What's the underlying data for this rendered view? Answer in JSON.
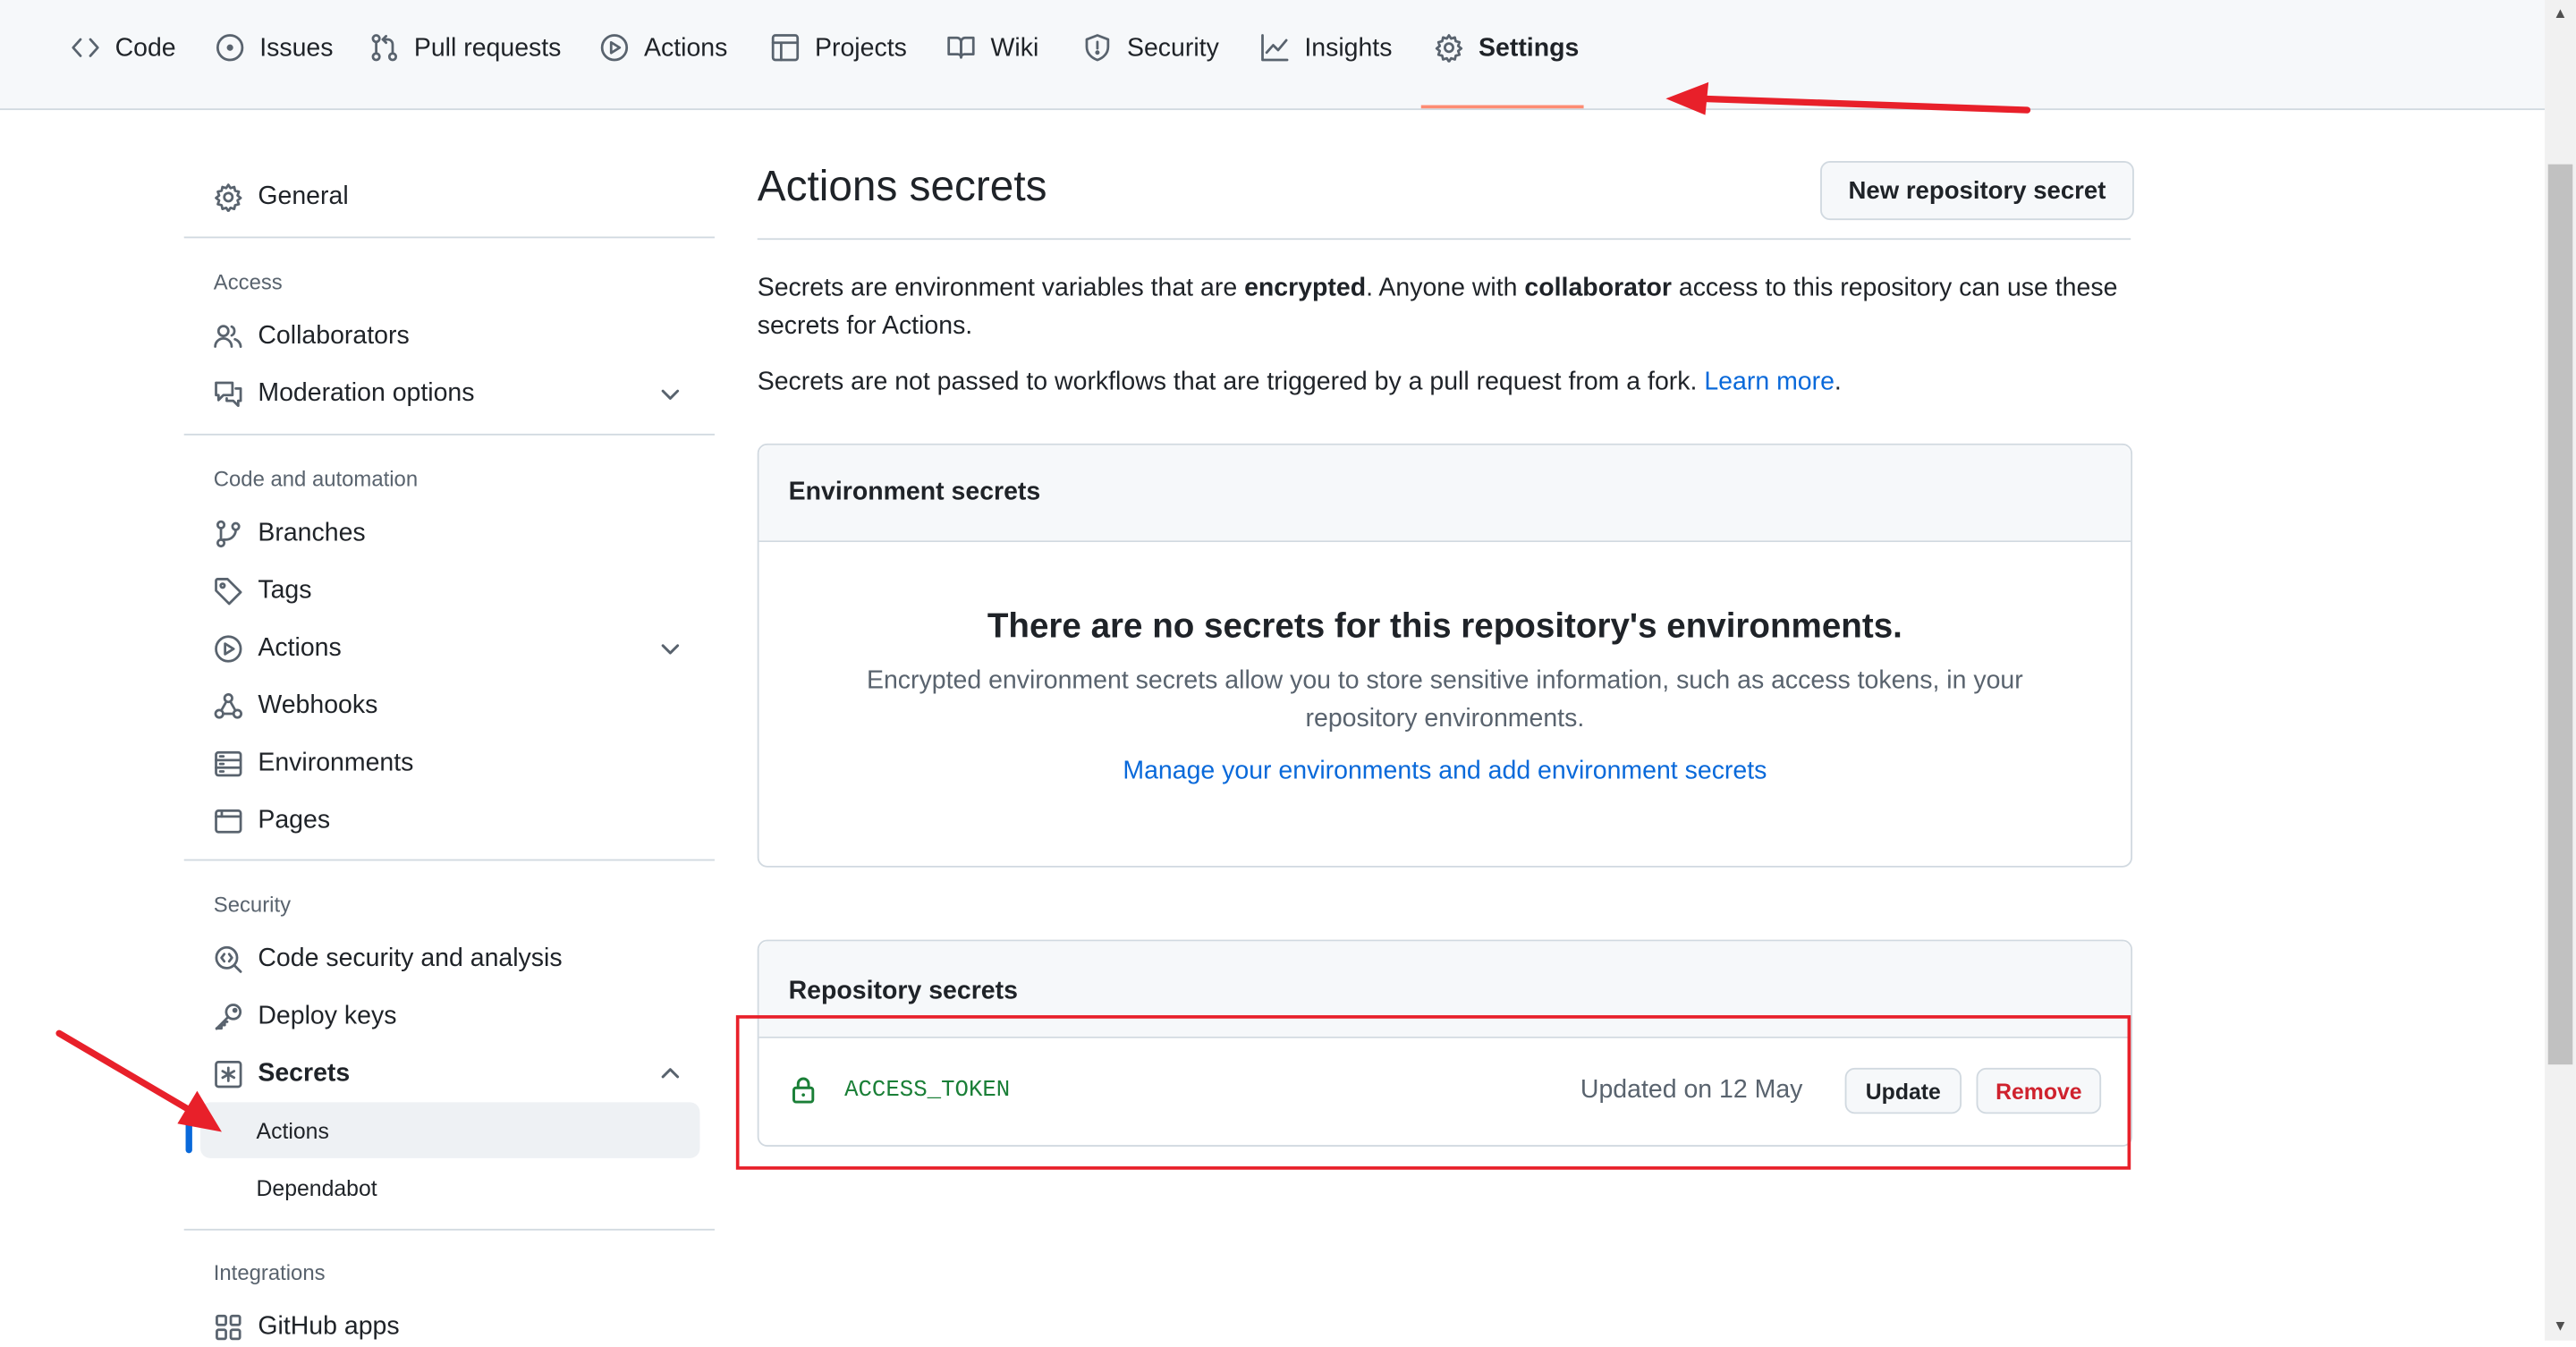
{
  "nav": {
    "tabs": [
      {
        "label": "Code",
        "icon": "code-icon"
      },
      {
        "label": "Issues",
        "icon": "issue-opened-icon"
      },
      {
        "label": "Pull requests",
        "icon": "git-pull-request-icon"
      },
      {
        "label": "Actions",
        "icon": "play-icon"
      },
      {
        "label": "Projects",
        "icon": "table-icon"
      },
      {
        "label": "Wiki",
        "icon": "book-icon"
      },
      {
        "label": "Security",
        "icon": "shield-icon"
      },
      {
        "label": "Insights",
        "icon": "graph-icon"
      },
      {
        "label": "Settings",
        "icon": "gear-icon",
        "selected": true
      }
    ],
    "selected_underline_color": "#fd8c73"
  },
  "sidebar": {
    "general": "General",
    "access": {
      "heading": "Access",
      "collaborators": "Collaborators",
      "moderation": "Moderation options"
    },
    "code_automation": {
      "heading": "Code and automation",
      "branches": "Branches",
      "tags": "Tags",
      "actions": "Actions",
      "webhooks": "Webhooks",
      "environments": "Environments",
      "pages": "Pages"
    },
    "security": {
      "heading": "Security",
      "code_security": "Code security and analysis",
      "deploy_keys": "Deploy keys",
      "secrets": "Secrets",
      "secrets_children": [
        "Actions",
        "Dependabot"
      ]
    },
    "integrations": {
      "heading": "Integrations",
      "github_apps": "GitHub apps"
    }
  },
  "main": {
    "title": "Actions secrets",
    "new_secret_button": "New repository secret",
    "intro": {
      "p1_a": "Secrets are environment variables that are ",
      "p1_b": "encrypted",
      "p1_c": ". Anyone with ",
      "p1_d": "collaborator",
      "p1_e": " access to this repository can use these secrets for Actions.",
      "p2": "Secrets are not passed to workflows that are triggered by a pull request from a fork. ",
      "learn_more": "Learn more",
      "period": "."
    },
    "environment_secrets": {
      "heading": "Environment secrets",
      "empty_title": "There are no secrets for this repository's environments.",
      "empty_desc": "Encrypted environment secrets allow you to store sensitive information, such as access tokens, in your repository environments.",
      "manage_link": "Manage your environments and add environment secrets"
    },
    "repository_secrets": {
      "heading": "Repository secrets",
      "rows": [
        {
          "name": "ACCESS_TOKEN",
          "updated": "Updated on 12 May",
          "update_button": "Update",
          "remove_button": "Remove"
        }
      ]
    }
  },
  "colors": {
    "link": "#0969da",
    "secret_name": "#1a7f37",
    "danger": "#cf222e",
    "annotation": "#e8202a"
  }
}
